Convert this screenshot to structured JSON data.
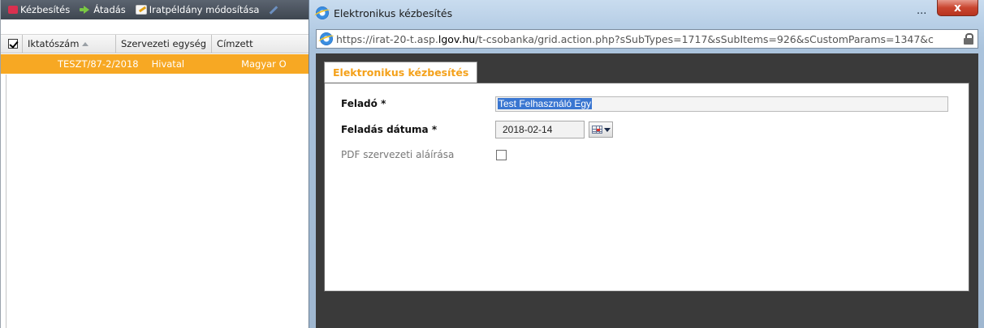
{
  "background_app": {
    "toolbar": {
      "kezbesites": "Kézbesítés",
      "atadas": "Átadás",
      "iratpeldany_modositasa": "Iratpéldány módosítása"
    },
    "columns": {
      "iktatoszam": "Iktatószám",
      "szervezeti_egyseg": "Szervezeti egység",
      "cimzett": "Címzett"
    },
    "select_all_checked": true,
    "selected_row": {
      "iktatoszam": "TESZT/87-2/2018",
      "szervezeti_egyseg": "Hivatal",
      "cimzett": "Magyar O"
    },
    "row_highlight_color": "#f7a823"
  },
  "popup": {
    "title": "Elektronikus kézbesítés",
    "minimize_label": "...",
    "close_label": "x",
    "address": {
      "prefix": "https://irat-20-t.asp.",
      "domain": "lgov.hu",
      "suffix": "/t-csobanka/grid.action.php?sSubTypes=1717&sSubItems=926&sCustomParams=1347&c"
    },
    "tab": "Elektronikus kézbesítés",
    "tab_color": "#f4a11a",
    "form": {
      "sender_label": "Feladó *",
      "sender_value": "Test Felhasználó Egy",
      "date_label": "Feladás dátuma *",
      "date_value": "2018-02-14",
      "pdf_label": "PDF szervezeti aláírása",
      "pdf_checked": false
    }
  }
}
